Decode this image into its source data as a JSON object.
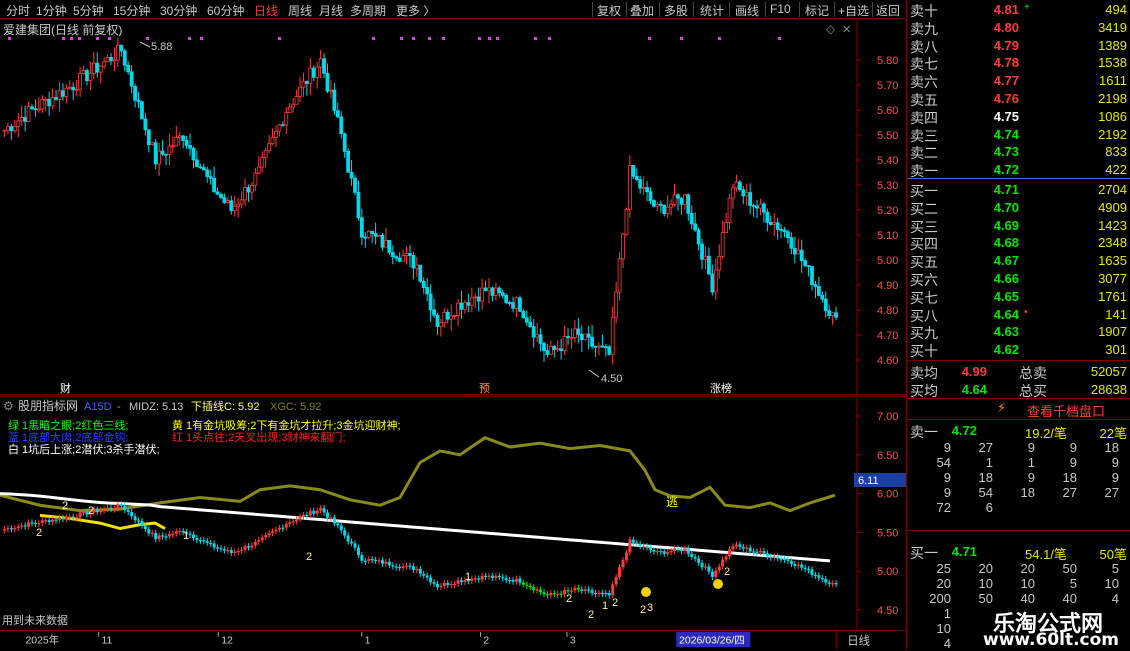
{
  "toolbar": {
    "items": [
      "分时",
      "1分钟",
      "5分钟",
      "15分钟",
      "30分钟",
      "60分钟",
      "日线",
      "周线",
      "月线",
      "多周期",
      "更多 〉"
    ],
    "right_items": [
      "复权",
      "叠加",
      "多股",
      "统计",
      "画线",
      "F10",
      "标记",
      "+自选",
      "返回"
    ]
  },
  "main_chart": {
    "title": "爱建集团(日线 前复权)",
    "high_label": "5.88",
    "low_label": "4.50",
    "y_ticks": [
      "5.80",
      "5.70",
      "5.60",
      "5.50",
      "5.40",
      "5.30",
      "5.20",
      "5.10",
      "5.00",
      "4.90",
      "4.80",
      "4.70",
      "4.60"
    ],
    "markers": [
      "财",
      "预",
      "涨榜"
    ]
  },
  "indicator": {
    "name": "股朋指标网",
    "param": "A15D",
    "midz_label": "MIDZ: 5.13",
    "xiacha_label": "下插线C: 5.92",
    "xgc_label": "XGC: 5.92",
    "legend_green": "绿 1黑暗之眼;2红色三线;",
    "legend_blue": "蓝 1底部大肉;2底部金钩;",
    "legend_white": "白 1坑后上涨;2潜伏;3杀手潜伏;",
    "legend_yellow": "黄 1有金坑吸筹;2下有金坑才拉升;3金坑迎财神;",
    "legend_red": "红 1头点往;2天叉出现;3财神来翻门;",
    "current_value": "6.11",
    "y_ticks": [
      "7.00",
      "6.50",
      "6.00",
      "5.50",
      "5.00",
      "4.50"
    ],
    "exit_label": "逃",
    "footer": "用到未来数据"
  },
  "bottom_axis": {
    "year": "2025年",
    "months": [
      "11",
      "12",
      "1",
      "2",
      "3"
    ],
    "date_highlight": "2026/03/26/四",
    "period": "日线"
  },
  "orderbook": {
    "sells": [
      {
        "label": "卖十",
        "price": "4.81",
        "vol": "494",
        "color": "#ff3b3b",
        "mark": "+"
      },
      {
        "label": "卖九",
        "price": "4.80",
        "vol": "3419",
        "color": "#ff3b3b",
        "mark": ""
      },
      {
        "label": "卖八",
        "price": "4.79",
        "vol": "1389",
        "color": "#ff3b3b",
        "mark": ""
      },
      {
        "label": "卖七",
        "price": "4.78",
        "vol": "1538",
        "color": "#ff3b3b",
        "mark": ""
      },
      {
        "label": "卖六",
        "price": "4.77",
        "vol": "1611",
        "color": "#ff3b3b",
        "mark": ""
      },
      {
        "label": "卖五",
        "price": "4.76",
        "vol": "2198",
        "color": "#ff3b3b",
        "mark": ""
      },
      {
        "label": "卖四",
        "price": "4.75",
        "vol": "1086",
        "color": "#ffffff",
        "mark": ""
      },
      {
        "label": "卖三",
        "price": "4.74",
        "vol": "2192",
        "color": "#00e600",
        "mark": ""
      },
      {
        "label": "卖二",
        "price": "4.73",
        "vol": "833",
        "color": "#00e600",
        "mark": ""
      },
      {
        "label": "卖一",
        "price": "4.72",
        "vol": "422",
        "color": "#00e600",
        "mark": ""
      }
    ],
    "buys": [
      {
        "label": "买一",
        "price": "4.71",
        "vol": "2704",
        "color": "#00e600",
        "mark": ""
      },
      {
        "label": "买二",
        "price": "4.70",
        "vol": "4909",
        "color": "#00e600",
        "mark": ""
      },
      {
        "label": "买三",
        "price": "4.69",
        "vol": "1423",
        "color": "#00e600",
        "mark": ""
      },
      {
        "label": "买四",
        "price": "4.68",
        "vol": "2348",
        "color": "#00e600",
        "mark": ""
      },
      {
        "label": "买五",
        "price": "4.67",
        "vol": "1635",
        "color": "#00e600",
        "mark": ""
      },
      {
        "label": "买六",
        "price": "4.66",
        "vol": "3077",
        "color": "#00e600",
        "mark": ""
      },
      {
        "label": "买七",
        "price": "4.65",
        "vol": "1761",
        "color": "#00e600",
        "mark": ""
      },
      {
        "label": "买八",
        "price": "4.64",
        "vol": "141",
        "color": "#00e600",
        "mark": "•"
      },
      {
        "label": "买九",
        "price": "4.63",
        "vol": "1907",
        "color": "#00e600",
        "mark": ""
      },
      {
        "label": "买十",
        "price": "4.62",
        "vol": "301",
        "color": "#00e600",
        "mark": ""
      }
    ],
    "sell_avg_label": "卖均",
    "sell_avg": "4.99",
    "total_sell_label": "总卖",
    "total_sell": "52057",
    "buy_avg_label": "买均",
    "buy_avg": "4.64",
    "total_buy_label": "总买",
    "total_buy": "28638",
    "view_button": "查看千档盘口",
    "sell1": {
      "label": "卖一",
      "price": "4.72",
      "per": "19.2/笔",
      "count": "22笔"
    },
    "sell1_grid": [
      [
        "9",
        "27",
        "9",
        "9",
        "18"
      ],
      [
        "54",
        "1",
        "1",
        "9",
        "9"
      ],
      [
        "9",
        "18",
        "9",
        "18",
        "9"
      ],
      [
        "9",
        "54",
        "18",
        "27",
        "27"
      ],
      [
        "72",
        "6",
        "",
        "",
        ""
      ]
    ],
    "buy1": {
      "label": "买一",
      "price": "4.71",
      "per": "54.1/笔",
      "count": "50笔"
    },
    "buy1_grid": [
      [
        "25",
        "20",
        "20",
        "50",
        "5"
      ],
      [
        "20",
        "10",
        "10",
        "5",
        "10"
      ],
      [
        "200",
        "50",
        "40",
        "40",
        "4"
      ],
      [
        "1",
        "1",
        "",
        "",
        ""
      ],
      [
        "10",
        "10",
        "",
        "",
        ""
      ],
      [
        "4",
        "",
        "",
        "",
        ""
      ]
    ]
  },
  "watermark": {
    "line1": "乐淘公式网",
    "line2": "www.60lt.com"
  }
}
